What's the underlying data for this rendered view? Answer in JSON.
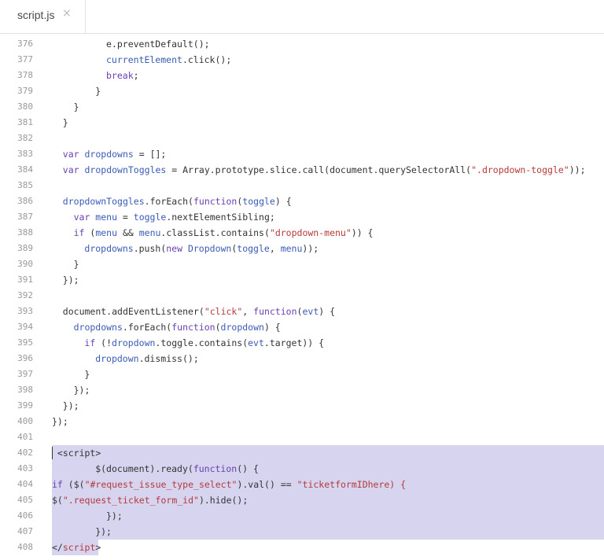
{
  "tab": {
    "label": "script.js",
    "close_glyph": "×"
  },
  "colors": {
    "keyword": "#6a3fb0",
    "variable": "#3b5bb5",
    "string": "#b53a3a",
    "plain": "#333333",
    "line_number": "#999999",
    "selection": "#d7d4f0"
  },
  "lines": [
    {
      "num": "376",
      "indent": 10,
      "hl": false,
      "tokens": [
        {
          "t": "e.preventDefault();",
          "c": "plain"
        }
      ]
    },
    {
      "num": "377",
      "indent": 10,
      "hl": false,
      "tokens": [
        {
          "t": "currentElement",
          "c": "var"
        },
        {
          "t": ".click();",
          "c": "plain"
        }
      ]
    },
    {
      "num": "378",
      "indent": 10,
      "hl": false,
      "tokens": [
        {
          "t": "break",
          "c": "kw"
        },
        {
          "t": ";",
          "c": "plain"
        }
      ]
    },
    {
      "num": "379",
      "indent": 8,
      "hl": false,
      "tokens": [
        {
          "t": "}",
          "c": "plain"
        }
      ]
    },
    {
      "num": "380",
      "indent": 4,
      "hl": false,
      "tokens": [
        {
          "t": "}",
          "c": "plain"
        }
      ]
    },
    {
      "num": "381",
      "indent": 2,
      "hl": false,
      "tokens": [
        {
          "t": "}",
          "c": "plain"
        }
      ]
    },
    {
      "num": "382",
      "indent": 0,
      "hl": false,
      "tokens": []
    },
    {
      "num": "383",
      "indent": 2,
      "hl": false,
      "tokens": [
        {
          "t": "var ",
          "c": "kw"
        },
        {
          "t": "dropdowns",
          "c": "var"
        },
        {
          "t": " = [];",
          "c": "plain"
        }
      ]
    },
    {
      "num": "384",
      "indent": 2,
      "hl": false,
      "tokens": [
        {
          "t": "var ",
          "c": "kw"
        },
        {
          "t": "dropdownToggles",
          "c": "var"
        },
        {
          "t": " = Array.prototype.slice.call(document.querySelectorAll(",
          "c": "plain"
        },
        {
          "t": "\".dropdown-toggle\"",
          "c": "str"
        },
        {
          "t": "));",
          "c": "plain"
        }
      ]
    },
    {
      "num": "385",
      "indent": 0,
      "hl": false,
      "tokens": []
    },
    {
      "num": "386",
      "indent": 2,
      "hl": false,
      "tokens": [
        {
          "t": "dropdownToggles",
          "c": "var"
        },
        {
          "t": ".forEach(",
          "c": "plain"
        },
        {
          "t": "function",
          "c": "kw"
        },
        {
          "t": "(",
          "c": "plain"
        },
        {
          "t": "toggle",
          "c": "var"
        },
        {
          "t": ") {",
          "c": "plain"
        }
      ]
    },
    {
      "num": "387",
      "indent": 4,
      "hl": false,
      "tokens": [
        {
          "t": "var ",
          "c": "kw"
        },
        {
          "t": "menu",
          "c": "var"
        },
        {
          "t": " = ",
          "c": "plain"
        },
        {
          "t": "toggle",
          "c": "var"
        },
        {
          "t": ".nextElementSibling;",
          "c": "plain"
        }
      ]
    },
    {
      "num": "388",
      "indent": 4,
      "hl": false,
      "tokens": [
        {
          "t": "if",
          "c": "kw"
        },
        {
          "t": " (",
          "c": "plain"
        },
        {
          "t": "menu",
          "c": "var"
        },
        {
          "t": " && ",
          "c": "plain"
        },
        {
          "t": "menu",
          "c": "var"
        },
        {
          "t": ".classList.contains(",
          "c": "plain"
        },
        {
          "t": "\"dropdown-menu\"",
          "c": "str"
        },
        {
          "t": ")) {",
          "c": "plain"
        }
      ]
    },
    {
      "num": "389",
      "indent": 6,
      "hl": false,
      "tokens": [
        {
          "t": "dropdowns",
          "c": "var"
        },
        {
          "t": ".push(",
          "c": "plain"
        },
        {
          "t": "new ",
          "c": "kw"
        },
        {
          "t": "Dropdown",
          "c": "var"
        },
        {
          "t": "(",
          "c": "plain"
        },
        {
          "t": "toggle",
          "c": "var"
        },
        {
          "t": ", ",
          "c": "plain"
        },
        {
          "t": "menu",
          "c": "var"
        },
        {
          "t": "));",
          "c": "plain"
        }
      ]
    },
    {
      "num": "390",
      "indent": 4,
      "hl": false,
      "tokens": [
        {
          "t": "}",
          "c": "plain"
        }
      ]
    },
    {
      "num": "391",
      "indent": 2,
      "hl": false,
      "tokens": [
        {
          "t": "});",
          "c": "plain"
        }
      ]
    },
    {
      "num": "392",
      "indent": 0,
      "hl": false,
      "tokens": []
    },
    {
      "num": "393",
      "indent": 2,
      "hl": false,
      "tokens": [
        {
          "t": "document.addEventListener(",
          "c": "plain"
        },
        {
          "t": "\"click\"",
          "c": "str"
        },
        {
          "t": ", ",
          "c": "plain"
        },
        {
          "t": "function",
          "c": "kw"
        },
        {
          "t": "(",
          "c": "plain"
        },
        {
          "t": "evt",
          "c": "var"
        },
        {
          "t": ") {",
          "c": "plain"
        }
      ]
    },
    {
      "num": "394",
      "indent": 4,
      "hl": false,
      "tokens": [
        {
          "t": "dropdowns",
          "c": "var"
        },
        {
          "t": ".forEach(",
          "c": "plain"
        },
        {
          "t": "function",
          "c": "kw"
        },
        {
          "t": "(",
          "c": "plain"
        },
        {
          "t": "dropdown",
          "c": "var"
        },
        {
          "t": ") {",
          "c": "plain"
        }
      ]
    },
    {
      "num": "395",
      "indent": 6,
      "hl": false,
      "tokens": [
        {
          "t": "if",
          "c": "kw"
        },
        {
          "t": " (!",
          "c": "plain"
        },
        {
          "t": "dropdown",
          "c": "var"
        },
        {
          "t": ".toggle.contains(",
          "c": "plain"
        },
        {
          "t": "evt",
          "c": "var"
        },
        {
          "t": ".target)) {",
          "c": "plain"
        }
      ]
    },
    {
      "num": "396",
      "indent": 8,
      "hl": false,
      "tokens": [
        {
          "t": "dropdown",
          "c": "var"
        },
        {
          "t": ".dismiss();",
          "c": "plain"
        }
      ]
    },
    {
      "num": "397",
      "indent": 6,
      "hl": false,
      "tokens": [
        {
          "t": "}",
          "c": "plain"
        }
      ]
    },
    {
      "num": "398",
      "indent": 4,
      "hl": false,
      "tokens": [
        {
          "t": "});",
          "c": "plain"
        }
      ]
    },
    {
      "num": "399",
      "indent": 2,
      "hl": false,
      "tokens": [
        {
          "t": "});",
          "c": "plain"
        }
      ]
    },
    {
      "num": "400",
      "indent": 0,
      "hl": false,
      "tokens": [
        {
          "t": "});",
          "c": "plain"
        }
      ]
    },
    {
      "num": "401",
      "indent": 0,
      "hl": false,
      "tokens": []
    },
    {
      "num": "402",
      "indent": 1,
      "hl": "full",
      "caret": true,
      "tokens": [
        {
          "t": "<script>",
          "c": "plain"
        }
      ]
    },
    {
      "num": "403",
      "indent": 8,
      "hl": "full",
      "tokens": [
        {
          "t": "$(document).ready(",
          "c": "plain"
        },
        {
          "t": "function",
          "c": "kw"
        },
        {
          "t": "() {",
          "c": "plain"
        }
      ]
    },
    {
      "num": "404",
      "indent": 0,
      "hl": "full",
      "tokens": [
        {
          "t": "if",
          "c": "kw"
        },
        {
          "t": " ($(",
          "c": "plain"
        },
        {
          "t": "\"#request_issue_type_select\"",
          "c": "str"
        },
        {
          "t": ").val() == ",
          "c": "plain"
        },
        {
          "t": "\"ticketformIDhere) {",
          "c": "str"
        }
      ]
    },
    {
      "num": "405",
      "indent": 0,
      "hl": "full",
      "tokens": [
        {
          "t": "$(",
          "c": "plain"
        },
        {
          "t": "\".request_ticket_form_id\"",
          "c": "str"
        },
        {
          "t": ").hide();",
          "c": "plain"
        }
      ]
    },
    {
      "num": "406",
      "indent": 10,
      "hl": "full",
      "tokens": [
        {
          "t": "});",
          "c": "plain"
        }
      ]
    },
    {
      "num": "407",
      "indent": 8,
      "hl": "full",
      "tokens": [
        {
          "t": "});",
          "c": "plain"
        }
      ]
    },
    {
      "num": "408",
      "indent": 0,
      "hl": "last",
      "tokens": [
        {
          "t": "</",
          "c": "plain"
        },
        {
          "t": "script",
          "c": "str"
        },
        {
          "t": ">",
          "c": "plain"
        }
      ]
    }
  ]
}
